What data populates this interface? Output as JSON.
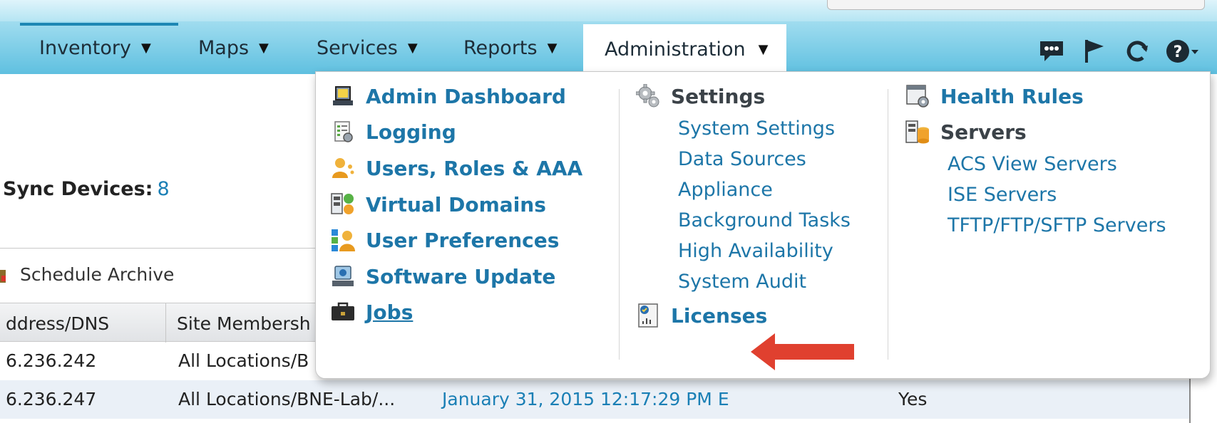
{
  "nav": {
    "items": [
      {
        "label": "Inventory"
      },
      {
        "label": "Maps"
      },
      {
        "label": "Services"
      },
      {
        "label": "Reports"
      }
    ],
    "active": {
      "label": "Administration"
    },
    "caret": "▼"
  },
  "toolbar_icons": [
    "chat-icon",
    "flag-icon",
    "refresh-icon",
    "help-icon"
  ],
  "background": {
    "sync_label": "Sync Devices:",
    "sync_value": "8",
    "schedule_label": "Schedule Archive",
    "columns": [
      "ddress/DNS",
      "Site Membersh"
    ],
    "rows": [
      {
        "address": "6.236.242",
        "site": "All Locations/B",
        "date": "",
        "flag": ""
      },
      {
        "address": "6.236.247",
        "site": "All Locations/BNE-Lab/...",
        "date": "January 31, 2015 12:17:29 PM E",
        "flag": "Yes"
      }
    ]
  },
  "menu": {
    "col1": [
      {
        "label": "Admin Dashboard",
        "icon": "admin-dashboard-icon"
      },
      {
        "label": "Logging",
        "icon": "logging-icon"
      },
      {
        "label": "Users, Roles & AAA",
        "icon": "users-icon"
      },
      {
        "label": "Virtual Domains",
        "icon": "virtual-domains-icon"
      },
      {
        "label": "User Preferences",
        "icon": "user-preferences-icon"
      },
      {
        "label": "Software Update",
        "icon": "software-update-icon"
      },
      {
        "label": "Jobs",
        "icon": "jobs-icon"
      }
    ],
    "col2": {
      "settings_label": "Settings",
      "settings_items": [
        "System Settings",
        "Data Sources",
        "Appliance",
        "Background Tasks",
        "High Availability",
        "System Audit"
      ],
      "licenses_label": "Licenses"
    },
    "col3": {
      "health_rules_label": "Health Rules",
      "servers_label": "Servers",
      "servers_items": [
        "ACS View Servers",
        "ISE Servers",
        "TFTP/FTP/SFTP Servers"
      ]
    }
  },
  "colors": {
    "accent": "#1d76a8",
    "nav_gradient_top": "#cfeef8",
    "nav_gradient_bottom": "#5fc0e0",
    "arrow": "#e0402f"
  }
}
